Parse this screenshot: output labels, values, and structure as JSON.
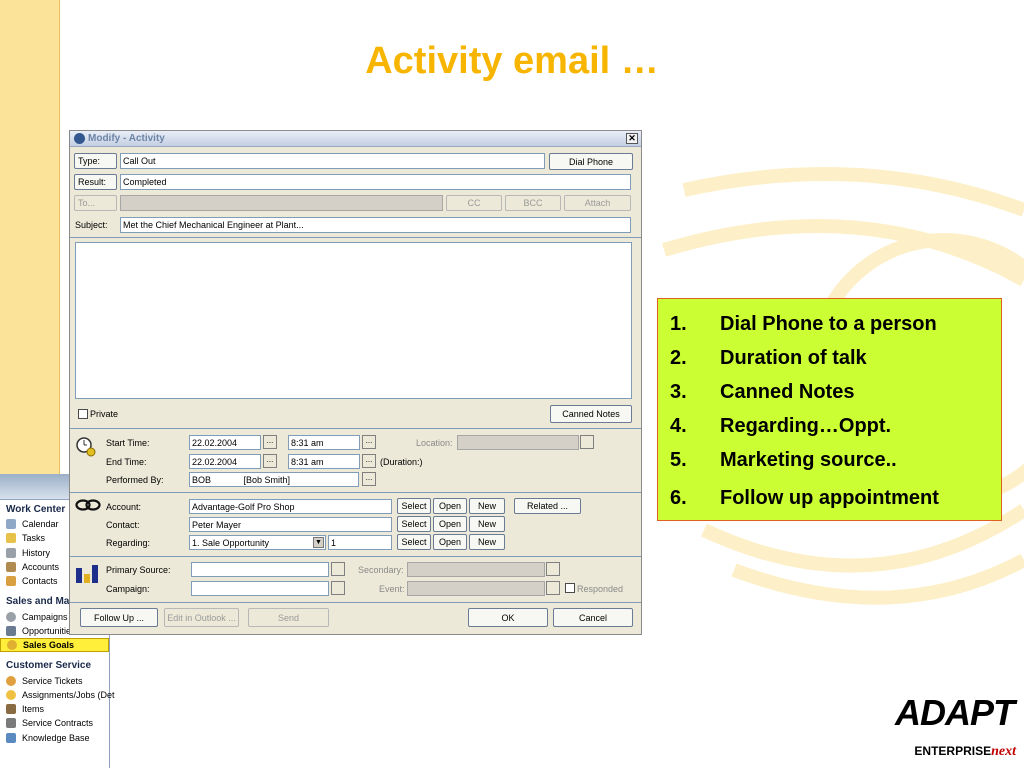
{
  "slide": {
    "title": "Activity email …"
  },
  "sidebar": {
    "work_center": "Work Center",
    "work_items": [
      "Calendar",
      "Tasks",
      "History",
      "Accounts",
      "Contacts"
    ],
    "sales_header": "Sales and Mark",
    "sales_items": [
      "Campaigns",
      "Opportunities",
      "Sales Goals"
    ],
    "service_header": "Customer Service",
    "service_items": [
      "Service Tickets",
      "Assignments/Jobs (Det",
      "Items",
      "Service Contracts",
      "Knowledge Base"
    ]
  },
  "dialog": {
    "title": "Modify - Activity",
    "type_label": "Type:",
    "type_value": "Call Out",
    "dial_phone": "Dial Phone",
    "result_label": "Result:",
    "result_value": "Completed",
    "to_label": "To...",
    "cc": "CC",
    "bcc": "BCC",
    "attach": "Attach",
    "subject_label": "Subject:",
    "subject_value": "Met the Chief Mechanical Engineer at Plant...",
    "private_label": "Private",
    "canned_notes": "Canned Notes",
    "start_time_label": "Start Time:",
    "start_date": "22.02.2004",
    "start_time": "8:31 am",
    "location_label": "Location:",
    "end_time_label": "End Time:",
    "end_date": "22.02.2004",
    "end_time": "8:31 am",
    "duration": "(Duration:)",
    "performed_label": "Performed By:",
    "performed_value": "BOB             [Bob Smith]",
    "account_label": "Account:",
    "account_value": "Advantage-Golf Pro Shop",
    "contact_label": "Contact:",
    "contact_value": "Peter Mayer",
    "regarding_label": "Regarding:",
    "regarding_value": "1. Sale Opportunity",
    "regarding_num": "1",
    "select": "Select",
    "open": "Open",
    "new": "New",
    "related": "Related ...",
    "primary_source_label": "Primary Source:",
    "secondary_label": "Secondary:",
    "campaign_label": "Campaign:",
    "event_label": "Event:",
    "responded_label": "Responded",
    "follow_up": "Follow Up ...",
    "edit_outlook": "Edit in Outlook ...",
    "send": "Send",
    "ok": "OK",
    "cancel": "Cancel"
  },
  "callout": {
    "items": [
      {
        "num": "1.",
        "text": "Dial Phone to a person"
      },
      {
        "num": "2.",
        "text": "Duration of talk"
      },
      {
        "num": "3.",
        "text": "Canned Notes"
      },
      {
        "num": "4.",
        "text": "Regarding…Oppt."
      },
      {
        "num": "5.",
        "text": "Marketing source.."
      },
      {
        "num": "6.",
        "text": "Follow up appointment"
      }
    ]
  },
  "logo": {
    "brand": "ADAPT",
    "sub": "ENTERPRISE",
    "sub_accent": "next"
  },
  "colors": {
    "title": "#f7b500",
    "callout_bg": "#ccff33",
    "callout_border": "#e06020",
    "stripe": "#fbe49a"
  }
}
